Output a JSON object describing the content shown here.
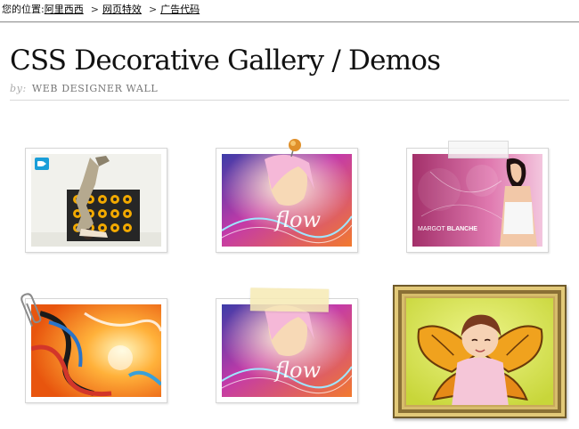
{
  "breadcrumb": {
    "prefix": "您的位置:",
    "links": [
      "阿里西西",
      "网页特效",
      "广告代码"
    ],
    "separator": ">"
  },
  "header": {
    "title": "CSS Decorative Gallery / Demos",
    "byline_by": "by:",
    "byline_author": "WEB DESIGNER WALL"
  },
  "gallery": {
    "items": [
      {
        "decoration": "video-icon",
        "scene": "breakdancer-speakers"
      },
      {
        "decoration": "push-pin",
        "scene": "flow-girl"
      },
      {
        "decoration": "clear-tape",
        "scene": "margot-blanche",
        "caption_a": "MARGOT",
        "caption_b": "BLANCHE"
      },
      {
        "decoration": "paper-clip",
        "scene": "abstract-swirls"
      },
      {
        "decoration": "tape",
        "scene": "flow-girl"
      },
      {
        "decoration": "gold-frame",
        "scene": "butterfly-girl"
      }
    ],
    "flow_text": "flow"
  },
  "colors": {
    "link": "#000000",
    "rule": "#d8d8d8",
    "video_badge": "#1a9ed8",
    "gold_frame": "#c8a95a"
  }
}
